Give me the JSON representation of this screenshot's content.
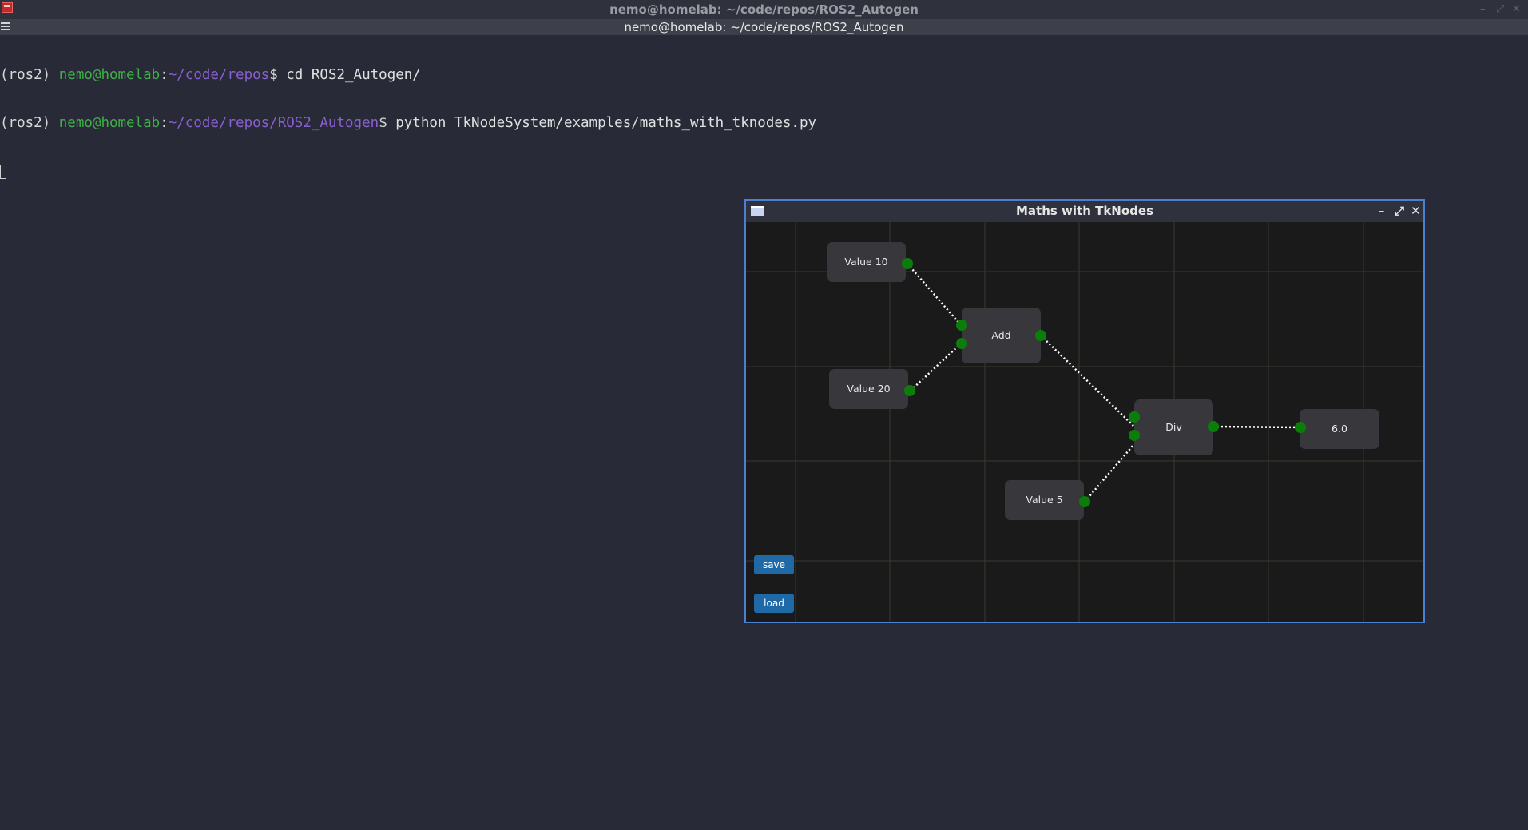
{
  "outer_window": {
    "title": "nemo@homelab: ~/code/repos/ROS2_Autogen",
    "controls": {
      "minimize": "–",
      "maximize": "⤢",
      "close": "✕"
    }
  },
  "tab": {
    "title": "nemo@homelab: ~/code/repos/ROS2_Autogen"
  },
  "terminal": {
    "lines": [
      {
        "env": "(ros2) ",
        "user": "nemo@homelab",
        "colon": ":",
        "path": "~/code/repos",
        "dollar": "$ ",
        "command": "cd ROS2_Autogen/"
      },
      {
        "env": "(ros2) ",
        "user": "nemo@homelab",
        "colon": ":",
        "path": "~/code/repos/ROS2_Autogen",
        "dollar": "$ ",
        "command": "python TkNodeSystem/examples/maths_with_tknodes.py"
      }
    ]
  },
  "app": {
    "title": "Maths with TkNodes",
    "controls": {
      "minimize": "–",
      "maximize": "⤢",
      "close": "✕"
    },
    "nodes": {
      "value10": "Value 10",
      "value20": "Value 20",
      "add": "Add",
      "div": "Div",
      "value5": "Value 5",
      "output": "6.0"
    },
    "buttons": {
      "save": "save",
      "load": "load"
    },
    "colors": {
      "port": "#0b7d0b",
      "node_bg": "#38383c",
      "canvas_bg": "#1a1a1a",
      "button": "#1f6aa6",
      "border": "#4a7fd1"
    }
  }
}
